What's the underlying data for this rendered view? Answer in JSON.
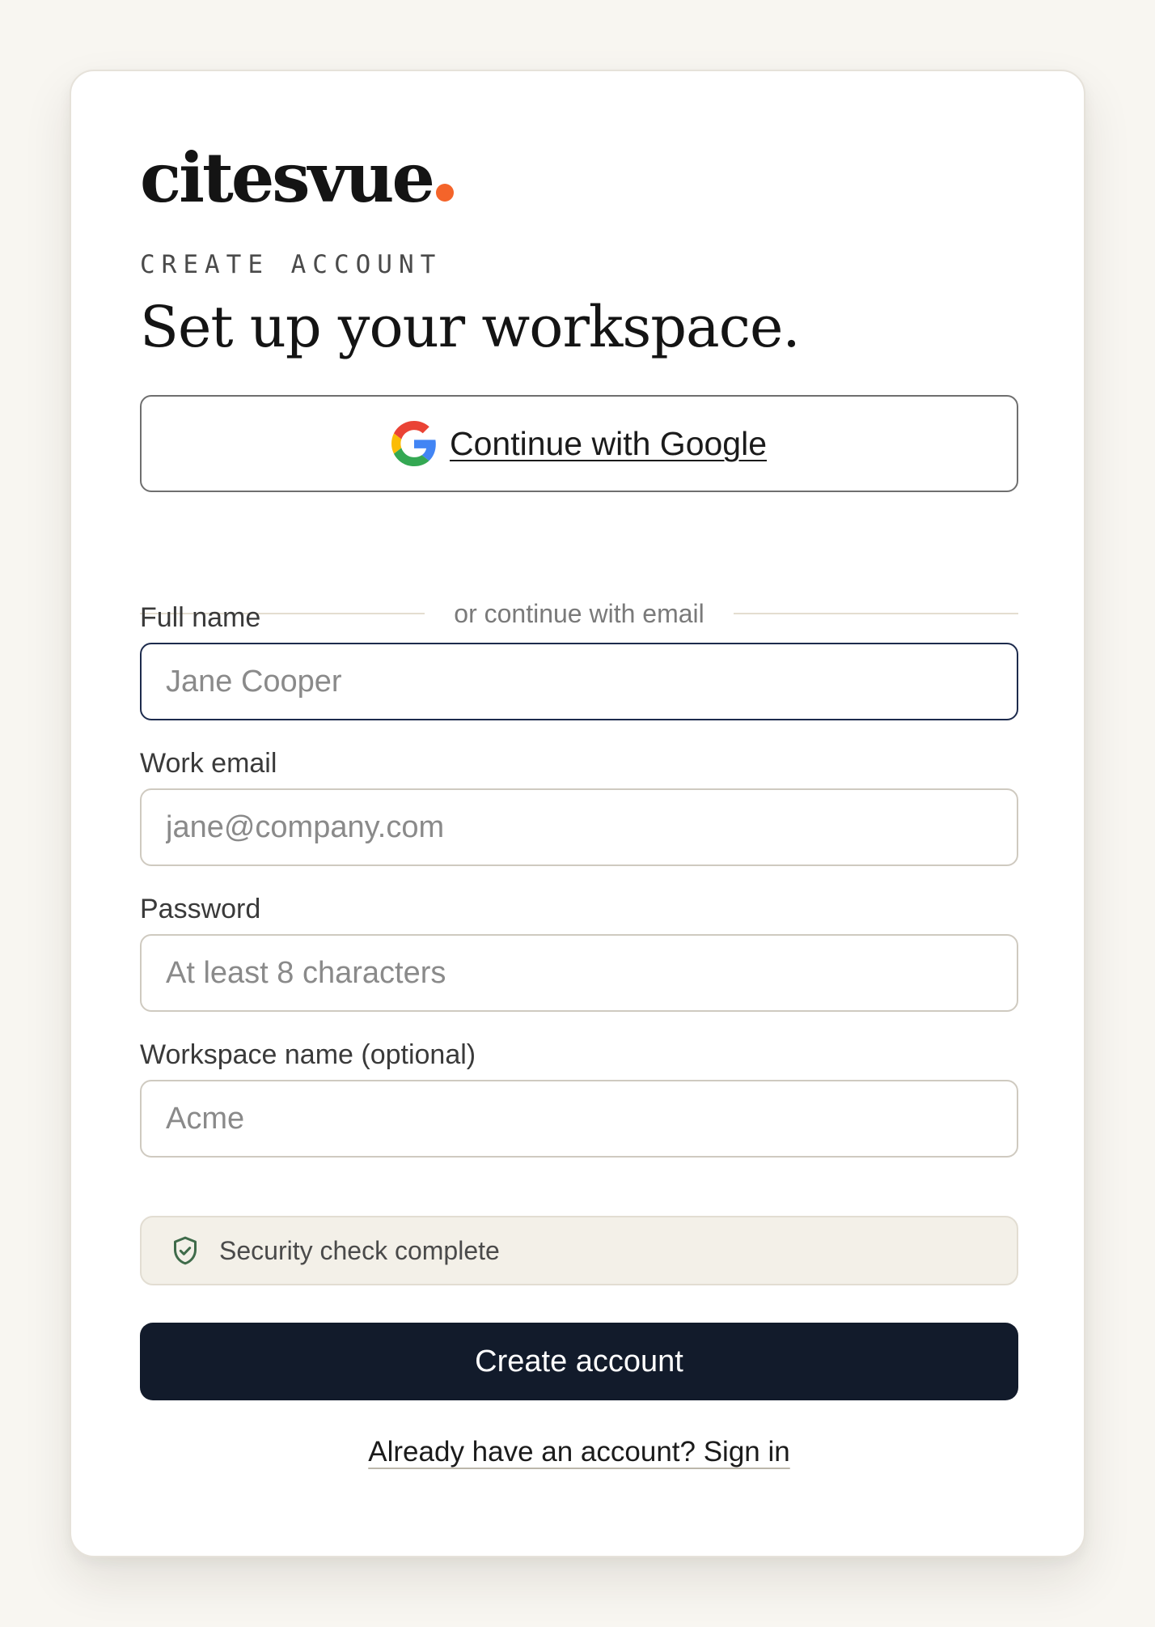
{
  "brand": {
    "name": "citesvue",
    "dot_color": "#f4642a"
  },
  "header": {
    "eyebrow": "CREATE ACCOUNT",
    "title": "Set up your workspace."
  },
  "google_button": {
    "label": "Continue with Google",
    "icon": "google-g-icon"
  },
  "divider": {
    "text": "or continue with email"
  },
  "fields": [
    {
      "label": "Full name",
      "placeholder": "Jane Cooper",
      "value": "",
      "focused": true
    },
    {
      "label": "Work email",
      "placeholder": "jane@company.com",
      "value": ""
    },
    {
      "label": "Password",
      "placeholder": "At least 8 characters",
      "value": ""
    },
    {
      "label": "Workspace name (optional)",
      "placeholder": "Acme",
      "value": ""
    }
  ],
  "security": {
    "icon": "shield-check-icon",
    "text": "Security check complete",
    "icon_color": "#3f6b4a"
  },
  "create_button": {
    "label": "Create account",
    "bg_color": "#121b2b"
  },
  "signin_link": {
    "label": "Already have an account? Sign in"
  }
}
